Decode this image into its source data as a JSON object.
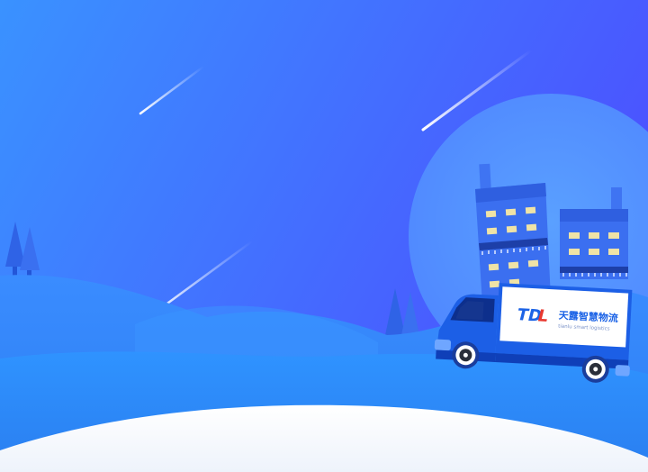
{
  "scene": {
    "description_free": true
  },
  "logo": {
    "mark_part1": "TD",
    "mark_part2": "L",
    "name_cn": "天露智慧物流",
    "name_en": "tianlu smart logistics"
  },
  "colors": {
    "sky_top": "#3d8bff",
    "sky_bottom": "#4a55ff",
    "moon": "#5c9cff",
    "hill_back": "#2f8cf8",
    "hill_front": "#2e88f6",
    "ground": "#ffffff",
    "truck_blue": "#1c5fe6",
    "truck_dark": "#0f3fb8",
    "logo_blue": "#1c63e6",
    "logo_red": "#e8382f",
    "window_light": "#f1e4a8"
  }
}
